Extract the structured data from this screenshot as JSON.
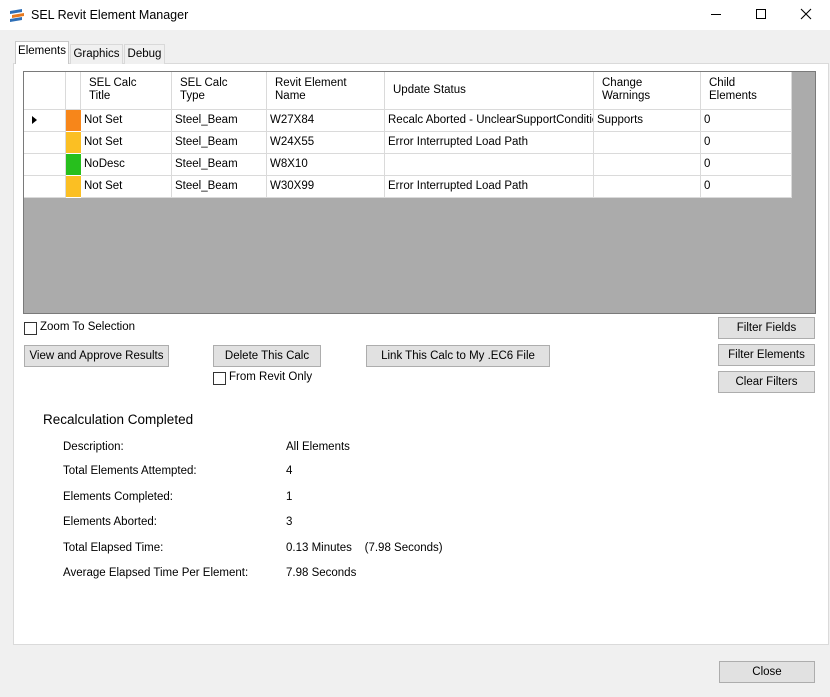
{
  "window": {
    "title": "SEL Revit Element Manager",
    "app_icon": "sel-logo-icon",
    "controls": [
      "minimize-icon",
      "maximize-icon",
      "close-icon"
    ]
  },
  "tabs": [
    {
      "label": "Elements",
      "active": true
    },
    {
      "label": "Graphics",
      "active": false
    },
    {
      "label": "Debug",
      "active": false
    }
  ],
  "grid": {
    "columns": [
      {
        "line1": "SEL Calc",
        "line2": "Title"
      },
      {
        "line1": "SEL Calc",
        "line2": "Type"
      },
      {
        "line1": "Revit Element",
        "line2": "Name"
      },
      {
        "line1": "Update Status",
        "line2": ""
      },
      {
        "line1": "Change",
        "line2": "Warnings"
      },
      {
        "line1": "Child",
        "line2": "Elements"
      }
    ],
    "rows": [
      {
        "status_color": "#f7861a",
        "selected": true,
        "title": "Not Set",
        "type": "Steel_Beam",
        "name": "W27X84",
        "update_status": "Recalc Aborted - UnclearSupportCondition",
        "warnings": "Supports",
        "children": "0"
      },
      {
        "status_color": "#fbbf23",
        "selected": false,
        "title": "Not Set",
        "type": "Steel_Beam",
        "name": "W24X55",
        "update_status": "Error Interrupted Load Path",
        "warnings": "",
        "children": "0"
      },
      {
        "status_color": "#27bf1d",
        "selected": false,
        "title": "NoDesc",
        "type": "Steel_Beam",
        "name": "W8X10",
        "update_status": "",
        "warnings": "",
        "children": "0"
      },
      {
        "status_color": "#fbbf23",
        "selected": false,
        "title": "Not Set",
        "type": "Steel_Beam",
        "name": "W30X99",
        "update_status": "Error Interrupted Load Path",
        "warnings": "",
        "children": "0"
      }
    ]
  },
  "controls": {
    "zoom_to_selection": "Zoom To Selection",
    "filter_fields": "Filter Fields",
    "view_approve": "View and Approve Results",
    "delete_calc": "Delete This Calc",
    "link_calc": "Link This Calc to My .EC6 File",
    "filter_elements": "Filter Elements",
    "from_revit_only": "From Revit Only",
    "clear_filters": "Clear Filters",
    "close": "Close"
  },
  "summary": {
    "title": "Recalculation Completed",
    "items": [
      {
        "label": "Description:",
        "value": "All Elements"
      },
      {
        "label": "Total Elements Attempted:",
        "value": "4"
      },
      {
        "label": "Elements Completed:",
        "value": "1"
      },
      {
        "label": "Elements Aborted:",
        "value": "3"
      },
      {
        "label": "Total Elapsed Time:",
        "value": "0.13 Minutes    (7.98 Seconds)"
      },
      {
        "label": "Average Elapsed Time Per Element:",
        "value": "7.98 Seconds"
      }
    ]
  }
}
